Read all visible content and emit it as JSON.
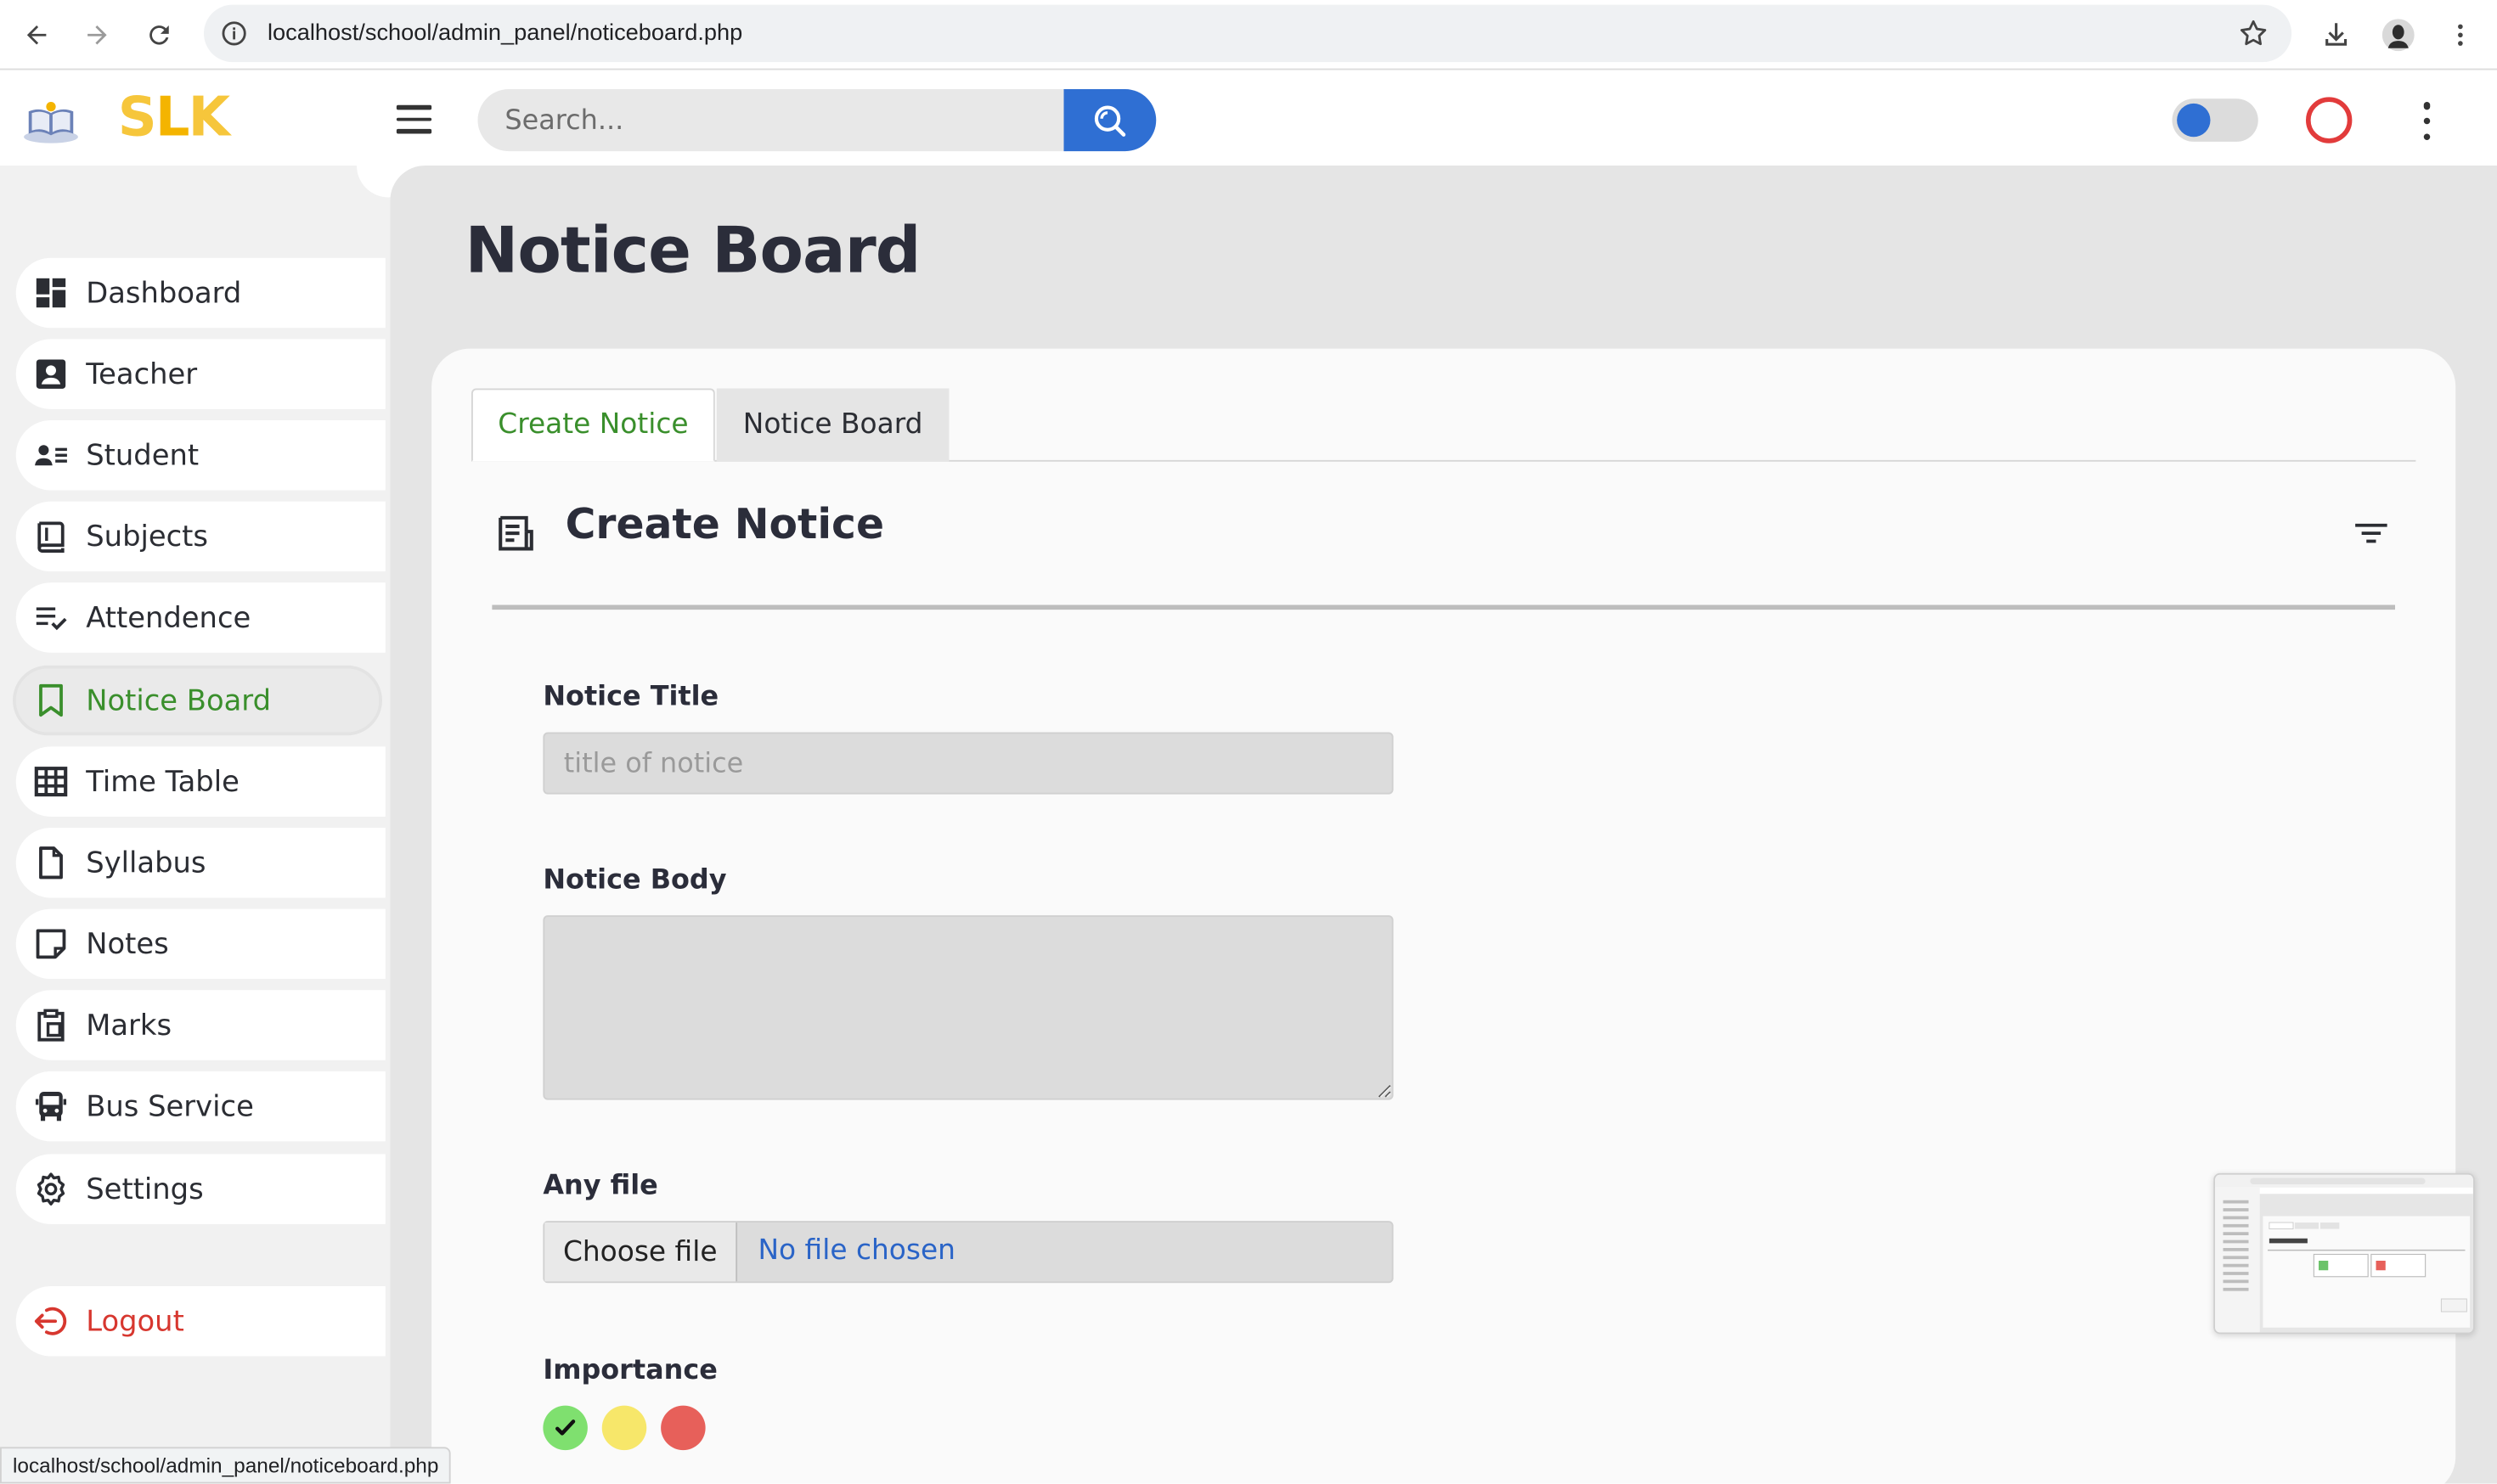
{
  "browser": {
    "url": "localhost/school/admin_panel/noticeboard.php"
  },
  "header": {
    "logo_text_s": "S",
    "logo_text_l": "L",
    "logo_text_k": "K",
    "search_placeholder": "Search..."
  },
  "sidebar": {
    "items": [
      {
        "label": "Dashboard",
        "icon": "dashboard-icon"
      },
      {
        "label": "Teacher",
        "icon": "teacher-icon"
      },
      {
        "label": "Student",
        "icon": "student-icon"
      },
      {
        "label": "Subjects",
        "icon": "book-icon"
      },
      {
        "label": "Attendence",
        "icon": "checklist-icon"
      },
      {
        "label": "Notice Board",
        "icon": "bookmark-icon",
        "active": true
      },
      {
        "label": "Time Table",
        "icon": "table-icon"
      },
      {
        "label": "Syllabus",
        "icon": "document-icon"
      },
      {
        "label": "Notes",
        "icon": "note-icon"
      },
      {
        "label": "Marks",
        "icon": "clipboard-icon"
      },
      {
        "label": "Bus Service",
        "icon": "bus-icon"
      },
      {
        "label": "Settings",
        "icon": "gear-icon"
      }
    ],
    "logout_label": "Logout"
  },
  "main": {
    "page_title": "Notice Board",
    "tabs": [
      {
        "label": "Create Notice",
        "active": true
      },
      {
        "label": "Notice Board",
        "active": false
      }
    ],
    "section_title": "Create Notice",
    "form": {
      "title_label": "Notice Title",
      "title_placeholder": "title of notice",
      "body_label": "Notice Body",
      "file_label": "Any file",
      "file_button": "Choose file",
      "file_status": "No file chosen",
      "importance_label": "Importance",
      "importance_levels": [
        {
          "color": "#7fe06f",
          "selected": true
        },
        {
          "color": "#f7e76a",
          "selected": false
        },
        {
          "color": "#e7605a",
          "selected": false
        }
      ]
    }
  },
  "status_bar": {
    "hover_url": "localhost/school/admin_panel/noticeboard.php"
  },
  "colors": {
    "accent_blue": "#2f6fd3",
    "active_green": "#3a8f2c",
    "logout_red": "#d7372f",
    "logo_yellow": "#f6c63b"
  }
}
